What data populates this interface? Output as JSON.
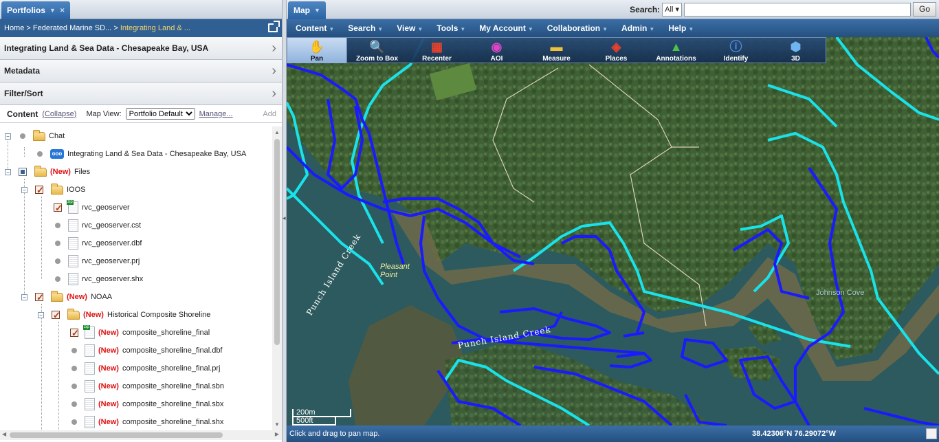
{
  "left_panel": {
    "tab_label": "Portfolios",
    "breadcrumb": {
      "home": "Home",
      "sep": ">",
      "parent": "Federated Marine SD...",
      "current": "Integrating Land & ..."
    },
    "accordion": [
      {
        "label": "Integrating Land & Sea Data - Chesapeake Bay, USA"
      },
      {
        "label": "Metadata"
      },
      {
        "label": "Filter/Sort"
      }
    ],
    "content_bar": {
      "title": "Content",
      "collapse": "(Collapse)",
      "map_view_label": "Map View:",
      "map_view_value": "Portfolio Default",
      "manage": "Manage...",
      "add": "Add"
    },
    "tree": [
      {
        "label": "Chat",
        "new": ""
      },
      {
        "label": "Integrating Land & Sea Data - Chesapeake Bay, USA",
        "new": ""
      },
      {
        "label": "Files",
        "new": "(New)"
      },
      {
        "label": "IOOS",
        "new": ""
      },
      {
        "label": "rvc_geoserver",
        "new": ""
      },
      {
        "label": "rvc_geoserver.cst",
        "new": ""
      },
      {
        "label": "rvc_geoserver.dbf",
        "new": ""
      },
      {
        "label": "rvc_geoserver.prj",
        "new": ""
      },
      {
        "label": "rvc_geoserver.shx",
        "new": ""
      },
      {
        "label": "NOAA",
        "new": "(New)"
      },
      {
        "label": "Historical Composite Shoreline",
        "new": "(New)"
      },
      {
        "label": "composite_shoreline_final",
        "new": "(New)"
      },
      {
        "label": "composite_shoreline_final.dbf",
        "new": "(New)"
      },
      {
        "label": "composite_shoreline_final.prj",
        "new": "(New)"
      },
      {
        "label": "composite_shoreline_final.sbn",
        "new": "(New)"
      },
      {
        "label": "composite_shoreline_final.sbx",
        "new": "(New)"
      },
      {
        "label": "composite_shoreline_final.shx",
        "new": "(New)"
      }
    ],
    "chat_icon_text": "ooo"
  },
  "map_panel": {
    "tab_label": "Map",
    "search_label": "Search:",
    "search_scope": "All",
    "search_value": "",
    "go_label": "Go",
    "menus": [
      "Content",
      "Search",
      "View",
      "Tools",
      "My Account",
      "Collaboration",
      "Admin",
      "Help"
    ],
    "tools": [
      {
        "label": "Pan",
        "icon": "hand-icon"
      },
      {
        "label": "Zoom to Box",
        "icon": "magnifier-icon"
      },
      {
        "label": "Recenter",
        "icon": "recenter-icon"
      },
      {
        "label": "AOI",
        "icon": "aoi-icon"
      },
      {
        "label": "Measure",
        "icon": "ruler-icon"
      },
      {
        "label": "Places",
        "icon": "places-icon"
      },
      {
        "label": "Annotations",
        "icon": "annotations-icon"
      },
      {
        "label": "Identify",
        "icon": "info-icon"
      },
      {
        "label": "3D",
        "icon": "cube-icon"
      }
    ],
    "map_labels": {
      "point": "Pleasant\nPoint",
      "creek1": "Punch Island Creek",
      "creek2": "Punch Island Creek",
      "cove": "Johnson Cove"
    },
    "scale": {
      "metric": "200m",
      "imperial": "500ft"
    },
    "status_text": "Click and drag to pan map.",
    "coordinates": "38.42306°N 76.29072°W",
    "colors": {
      "shoreline_dark": "#1a1aff",
      "shoreline_light": "#19e3ea",
      "menubar": "#2f5f93"
    }
  }
}
